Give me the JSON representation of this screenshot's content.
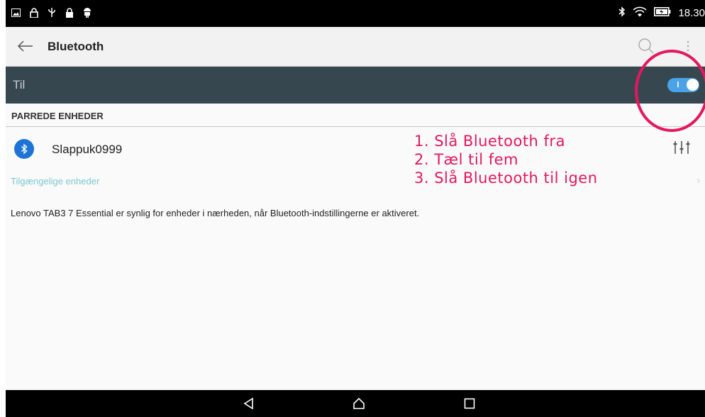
{
  "status_bar": {
    "time": "18.30",
    "icons": [
      "image-icon",
      "lock-icon",
      "usb-icon",
      "lock-icon",
      "android-icon",
      "bluetooth-icon",
      "wifi-icon",
      "battery-charging-icon"
    ]
  },
  "toolbar": {
    "title": "Bluetooth",
    "back_icon": "arrow-left-icon",
    "search_icon": "search-icon",
    "more_icon": "more-vertical-icon"
  },
  "master_switch": {
    "label": "Til",
    "state": "on",
    "accent": "#4aa3e8"
  },
  "paired_section": {
    "header": "PARREDE ENHEDER",
    "devices": [
      {
        "name": "Slappuk0999",
        "icon": "bluetooth-icon",
        "action_icon": "equalizer-settings-icon"
      }
    ]
  },
  "available_devices": {
    "label": "Tilgængelige enheder"
  },
  "visibility_note": "Lenovo TAB3 7 Essential er synlig for enheder i nærheden, når Bluetooth-indstillingerne er aktiveret.",
  "annotation": {
    "color": "#e6175c",
    "steps": [
      "1. Slå Bluetooth fra",
      "2. Tæl til fem",
      "3. Slå Bluetooth til igen"
    ]
  },
  "nav_bar": {
    "icons": [
      "back-triangle-icon",
      "home-icon",
      "recents-square-icon"
    ]
  },
  "colors": {
    "master_bar": "#37474f",
    "toolbar": "#f2f2f2",
    "available_label": "#7cc7d0",
    "bluetooth_blue": "#1e74d6"
  }
}
